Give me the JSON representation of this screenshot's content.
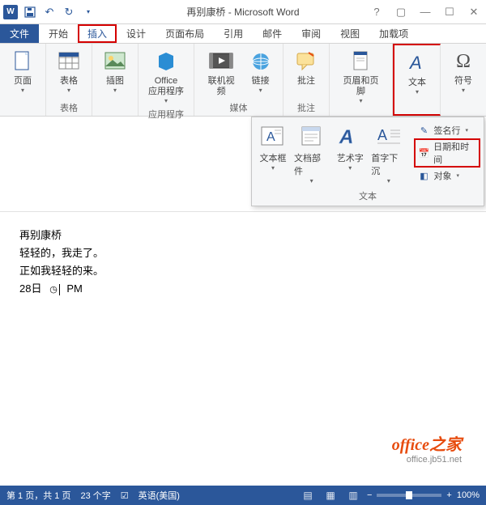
{
  "title": "再别康桥 - Microsoft Word",
  "qat": {
    "save": "💾",
    "undo": "↶",
    "redo": "↻"
  },
  "tabs": {
    "file": "文件",
    "home": "开始",
    "insert": "插入",
    "design": "设计",
    "layout": "页面布局",
    "references": "引用",
    "mail": "邮件",
    "review": "审阅",
    "view": "视图",
    "addins": "加载项"
  },
  "ribbon": {
    "pages": {
      "label": "页面"
    },
    "tables": {
      "btn": "表格",
      "group": "表格"
    },
    "illustrations": {
      "btn": "插图"
    },
    "apps": {
      "btn": "Office\n应用程序",
      "group": "应用程序"
    },
    "video": {
      "btn": "联机视频"
    },
    "links": {
      "btn": "链接"
    },
    "media_group": "媒体",
    "comment": {
      "btn": "批注",
      "group": "批注"
    },
    "header": {
      "btn": "页眉和页脚"
    },
    "text": {
      "btn": "文本"
    },
    "symbols": {
      "btn": "符号"
    }
  },
  "gallery": {
    "textbox": "文本框",
    "parts": "文档部件",
    "wordart": "艺术字",
    "dropcap": "首字下沉",
    "signature": "签名行",
    "datetime": "日期和时间",
    "object": "对象",
    "group_label": "文本"
  },
  "document": {
    "line1": "再别康桥",
    "line2": "轻轻的，我走了。",
    "line3": "正如我轻轻的来。",
    "line4_a": "28日",
    "line4_b": "PM"
  },
  "watermark": {
    "main": "office之家",
    "sub": "office.jb51.net"
  },
  "status": {
    "page": "第 1 页，共 1 页",
    "words": "23 个字",
    "lang": "英语(美国)",
    "zoom": "100%"
  }
}
